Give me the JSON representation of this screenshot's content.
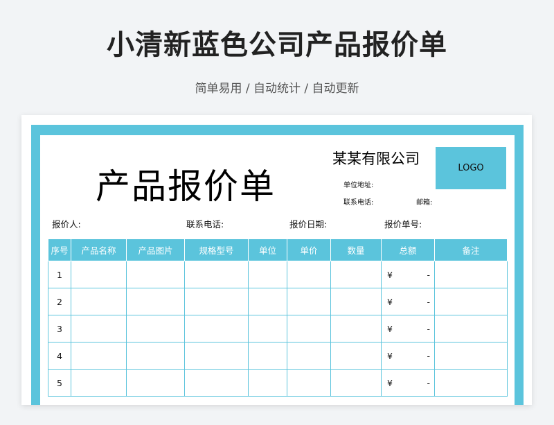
{
  "page": {
    "title": "小清新蓝色公司产品报价单",
    "subtitle": "简单易用 / 自动统计 / 自动更新"
  },
  "sheet": {
    "big_title": "产品报价单",
    "company_name": "某某有限公司",
    "address_label": "单位地址:",
    "phone_label": "联系电话:",
    "email_label": "邮箱:",
    "logo_text": "LOGO",
    "quoter_label": "报价人:",
    "contact_label": "联系电话:",
    "date_label": "报价日期:",
    "quote_no_label": "报价单号:"
  },
  "table": {
    "headers": [
      "序号",
      "产品名称",
      "产品图片",
      "规格型号",
      "单位",
      "单价",
      "数量",
      "总额",
      "备注"
    ],
    "rows": [
      {
        "index": "1",
        "currency": "¥",
        "total": "-"
      },
      {
        "index": "2",
        "currency": "¥",
        "total": "-"
      },
      {
        "index": "3",
        "currency": "¥",
        "total": "-"
      },
      {
        "index": "4",
        "currency": "¥",
        "total": "-"
      },
      {
        "index": "5",
        "currency": "¥",
        "total": "-"
      }
    ]
  },
  "colors": {
    "accent": "#5bc4dc",
    "background": "#f2f4f6"
  }
}
